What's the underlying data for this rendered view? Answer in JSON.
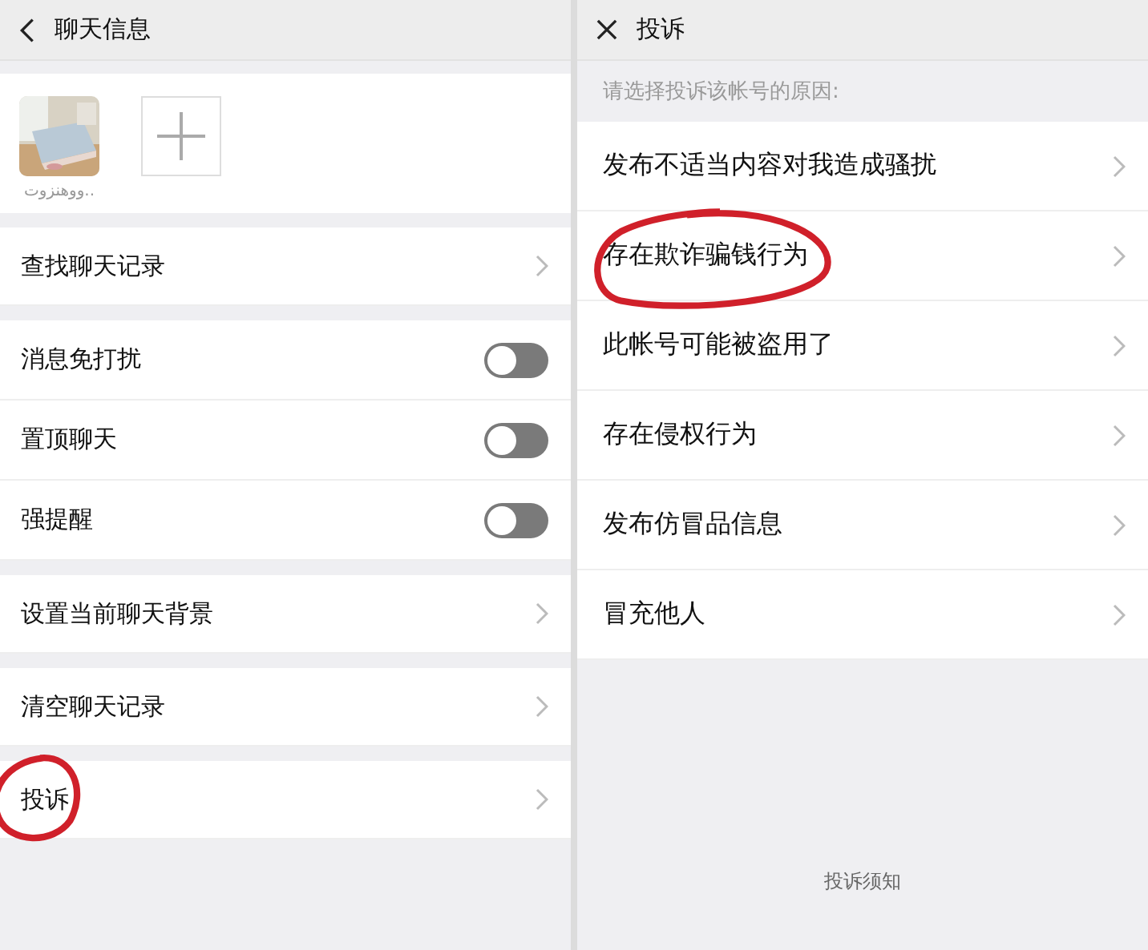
{
  "left": {
    "title": "聊天信息",
    "member": {
      "name": "ووهنزوت.."
    },
    "groups": [
      [
        {
          "kind": "link",
          "label": "查找聊天记录",
          "circled": false
        }
      ],
      [
        {
          "kind": "switch",
          "label": "消息免打扰",
          "on": false,
          "circled": false
        },
        {
          "kind": "switch",
          "label": "置顶聊天",
          "on": false,
          "circled": false
        },
        {
          "kind": "switch",
          "label": "强提醒",
          "on": false,
          "circled": false
        }
      ],
      [
        {
          "kind": "link",
          "label": "设置当前聊天背景",
          "circled": false
        }
      ],
      [
        {
          "kind": "link",
          "label": "清空聊天记录",
          "circled": false
        }
      ],
      [
        {
          "kind": "link",
          "label": "投诉",
          "circled": true
        }
      ]
    ]
  },
  "right": {
    "title": "投诉",
    "prompt": "请选择投诉该帐号的原因:",
    "reasons": [
      {
        "label": "发布不适当内容对我造成骚扰",
        "circled": false
      },
      {
        "label": "存在欺诈骗钱行为",
        "circled": true
      },
      {
        "label": "此帐号可能被盗用了",
        "circled": false
      },
      {
        "label": "存在侵权行为",
        "circled": false
      },
      {
        "label": "发布仿冒品信息",
        "circled": false
      },
      {
        "label": "冒充他人",
        "circled": false
      }
    ],
    "footer_link": "投诉须知"
  }
}
